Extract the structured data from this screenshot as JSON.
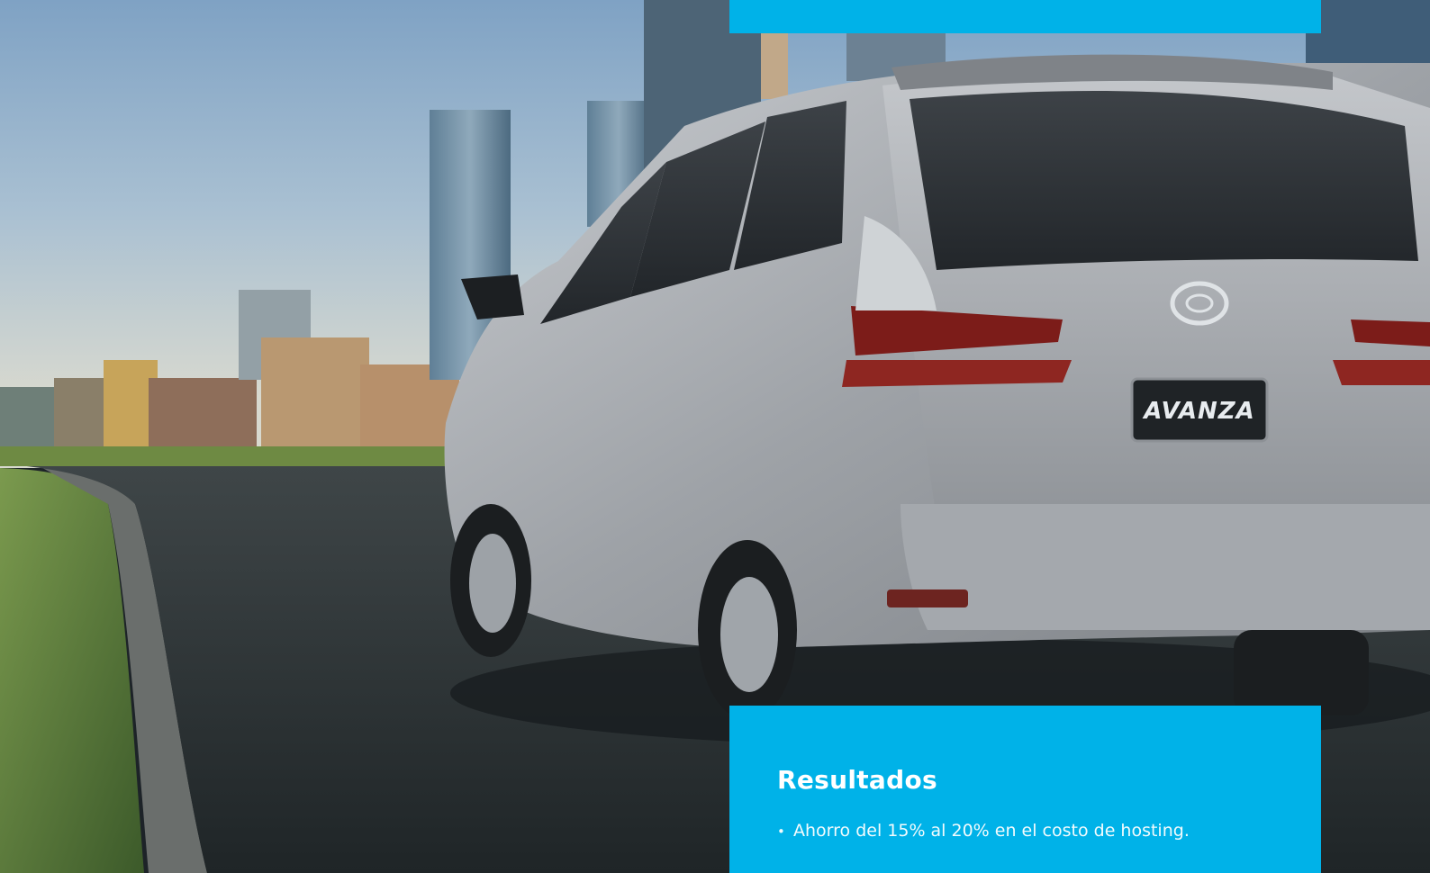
{
  "colors": {
    "accent_panel": "#00b2e8",
    "text_on_accent": "#ffffff"
  },
  "hero_image": {
    "alt": "Toyota Avanza",
    "emblem_text": "AVANZA",
    "badge_text": "AVANZA"
  },
  "results": {
    "title": "Resultados",
    "bullet_icon": "bullet-dot",
    "items": [
      {
        "text": "Ahorro del 15% al 20% en el costo de hosting."
      }
    ]
  }
}
